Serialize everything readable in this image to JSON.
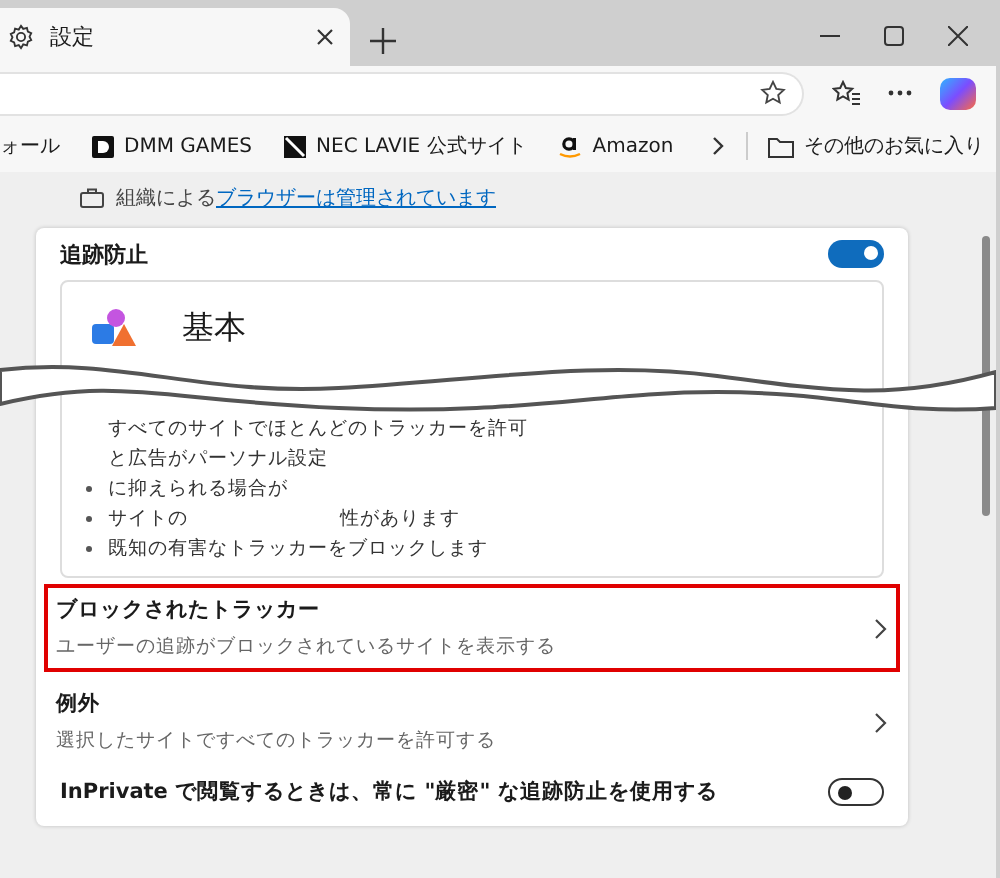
{
  "tab": {
    "title": "設定"
  },
  "bookmarks": {
    "items": [
      {
        "label": "ォール",
        "kind": "plain"
      },
      {
        "label": "DMM GAMES",
        "kind": "dmm"
      },
      {
        "label": "NEC LAVIE 公式サイト",
        "kind": "square"
      },
      {
        "label": "Amazon",
        "kind": "amazon"
      }
    ],
    "other": "その他のお気に入り"
  },
  "managed": {
    "prefix": "組織による",
    "link": "ブラウザーは管理されています"
  },
  "tracking": {
    "title": "追跡防止",
    "on": true,
    "level_card": {
      "title": "基本",
      "bullets": [
        {
          "bullet": false,
          "parts": [
            "すべてのサイトでほとんどのトラッカーを許可"
          ]
        },
        {
          "bullet": false,
          "parts": [
            "と広告がパーソナル設定"
          ]
        },
        {
          "bullet": true,
          "parts": [
            "に抑えられる場合が"
          ]
        },
        {
          "bullet": true,
          "parts": [
            "サイトの",
            "性があります"
          ]
        },
        {
          "bullet": true,
          "parts": [
            "既知の有害なトラッカーをブロックします"
          ]
        }
      ]
    },
    "rows": [
      {
        "title": "ブロックされたトラッカー",
        "subtitle": "ユーザーの追跡がブロックされているサイトを表示する",
        "highlighted": true
      },
      {
        "title": "例外",
        "subtitle": "選択したサイトですべてのトラッカーを許可する",
        "highlighted": false
      }
    ],
    "inprivate": {
      "label": "InPrivate で閲覧するときは、常に \"厳密\" な追跡防止を使用する",
      "on": false
    }
  }
}
